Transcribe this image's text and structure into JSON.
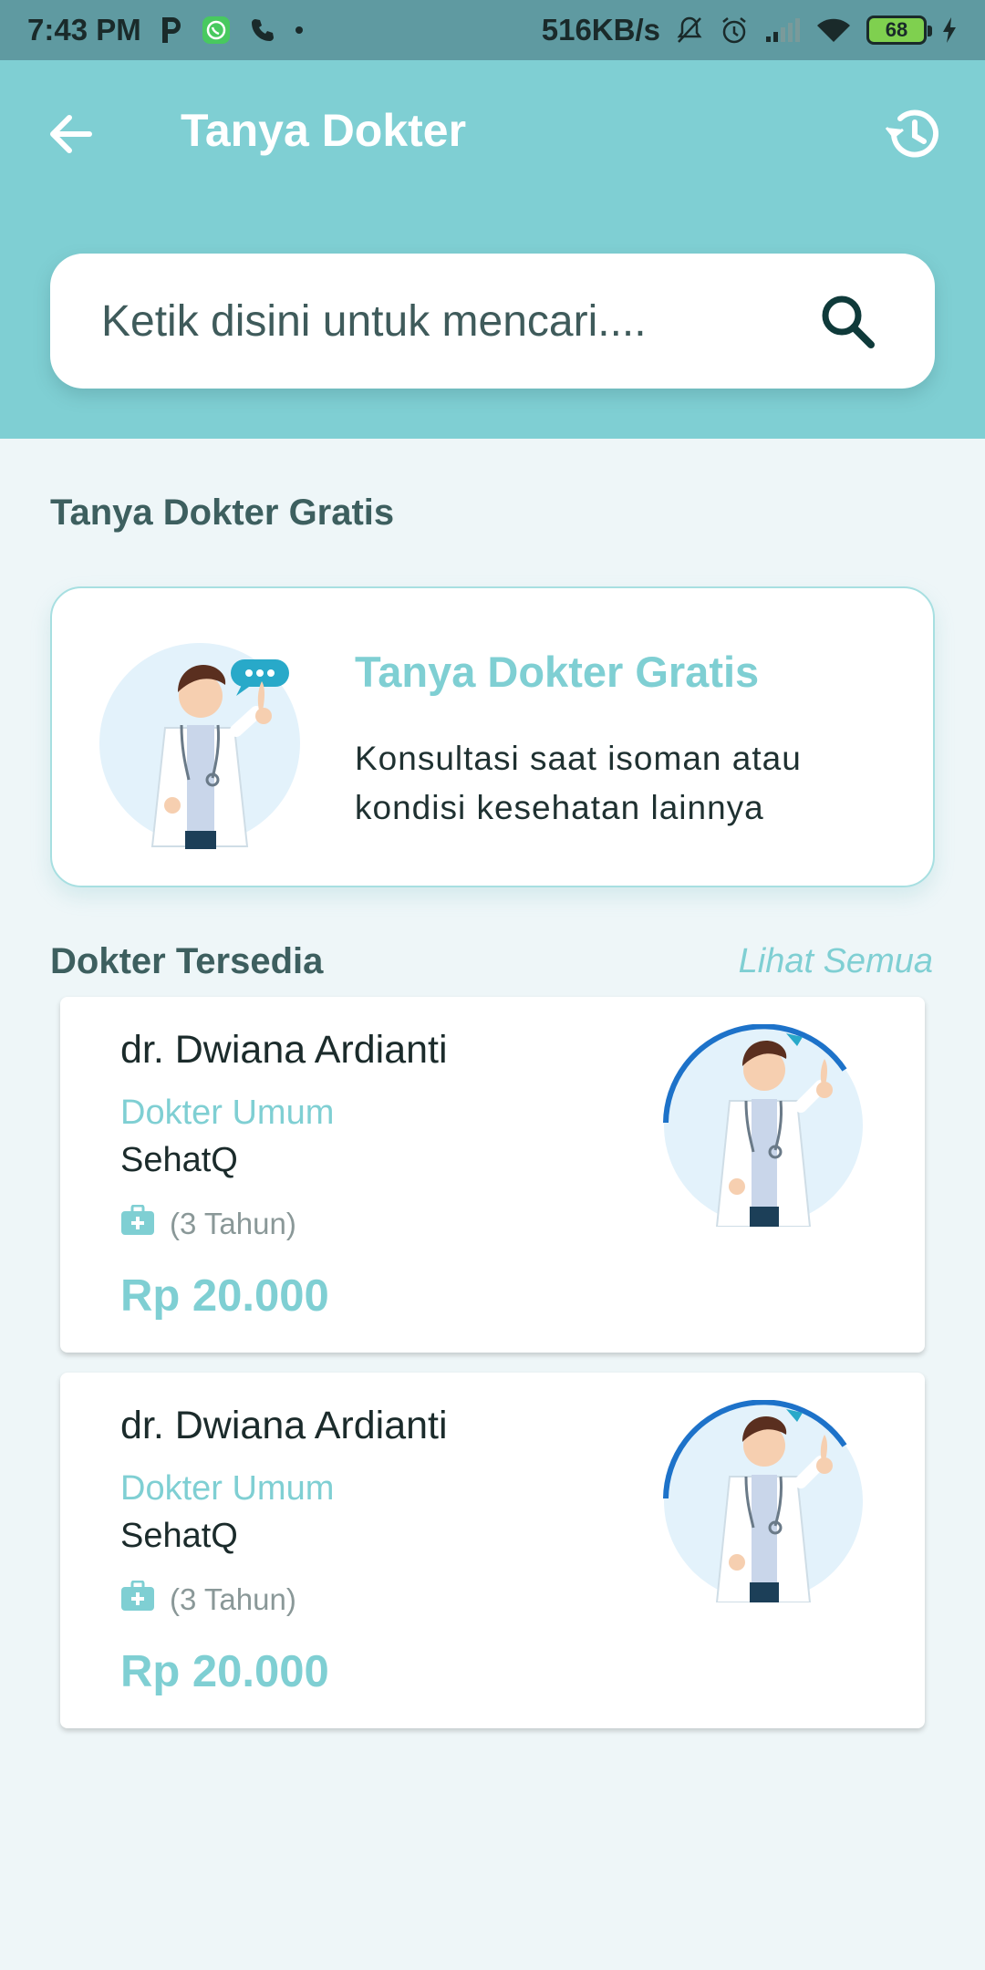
{
  "status_bar": {
    "time": "7:43 PM",
    "speed": "516KB/s",
    "battery": "68"
  },
  "header": {
    "title": "Tanya Dokter"
  },
  "search": {
    "placeholder": "Ketik disini untuk mencari...."
  },
  "free_section": {
    "heading": "Tanya Dokter Gratis",
    "card": {
      "title": "Tanya Dokter Gratis",
      "description": "Konsultasi saat isoman atau kondisi kesehatan lainnya"
    }
  },
  "doctors_section": {
    "heading": "Dokter Tersedia",
    "see_all": "Lihat Semua",
    "doctors": [
      {
        "name": "dr. Dwiana Ardianti",
        "specialty": "Dokter Umum",
        "organization": "SehatQ",
        "experience": "(3 Tahun)",
        "price": "Rp 20.000"
      },
      {
        "name": "dr. Dwiana Ardianti",
        "specialty": "Dokter Umum",
        "organization": "SehatQ",
        "experience": "(3 Tahun)",
        "price": "Rp 20.000"
      }
    ]
  },
  "colors": {
    "header_bg": "#7fcfd3",
    "accent": "#7fcfd3",
    "page_bg": "#eef6f8",
    "status_bar_bg": "#5f9aa1"
  },
  "icons": [
    "back-arrow-icon",
    "history-icon",
    "search-icon",
    "medical-kit-icon",
    "doctor-avatar-icon"
  ]
}
